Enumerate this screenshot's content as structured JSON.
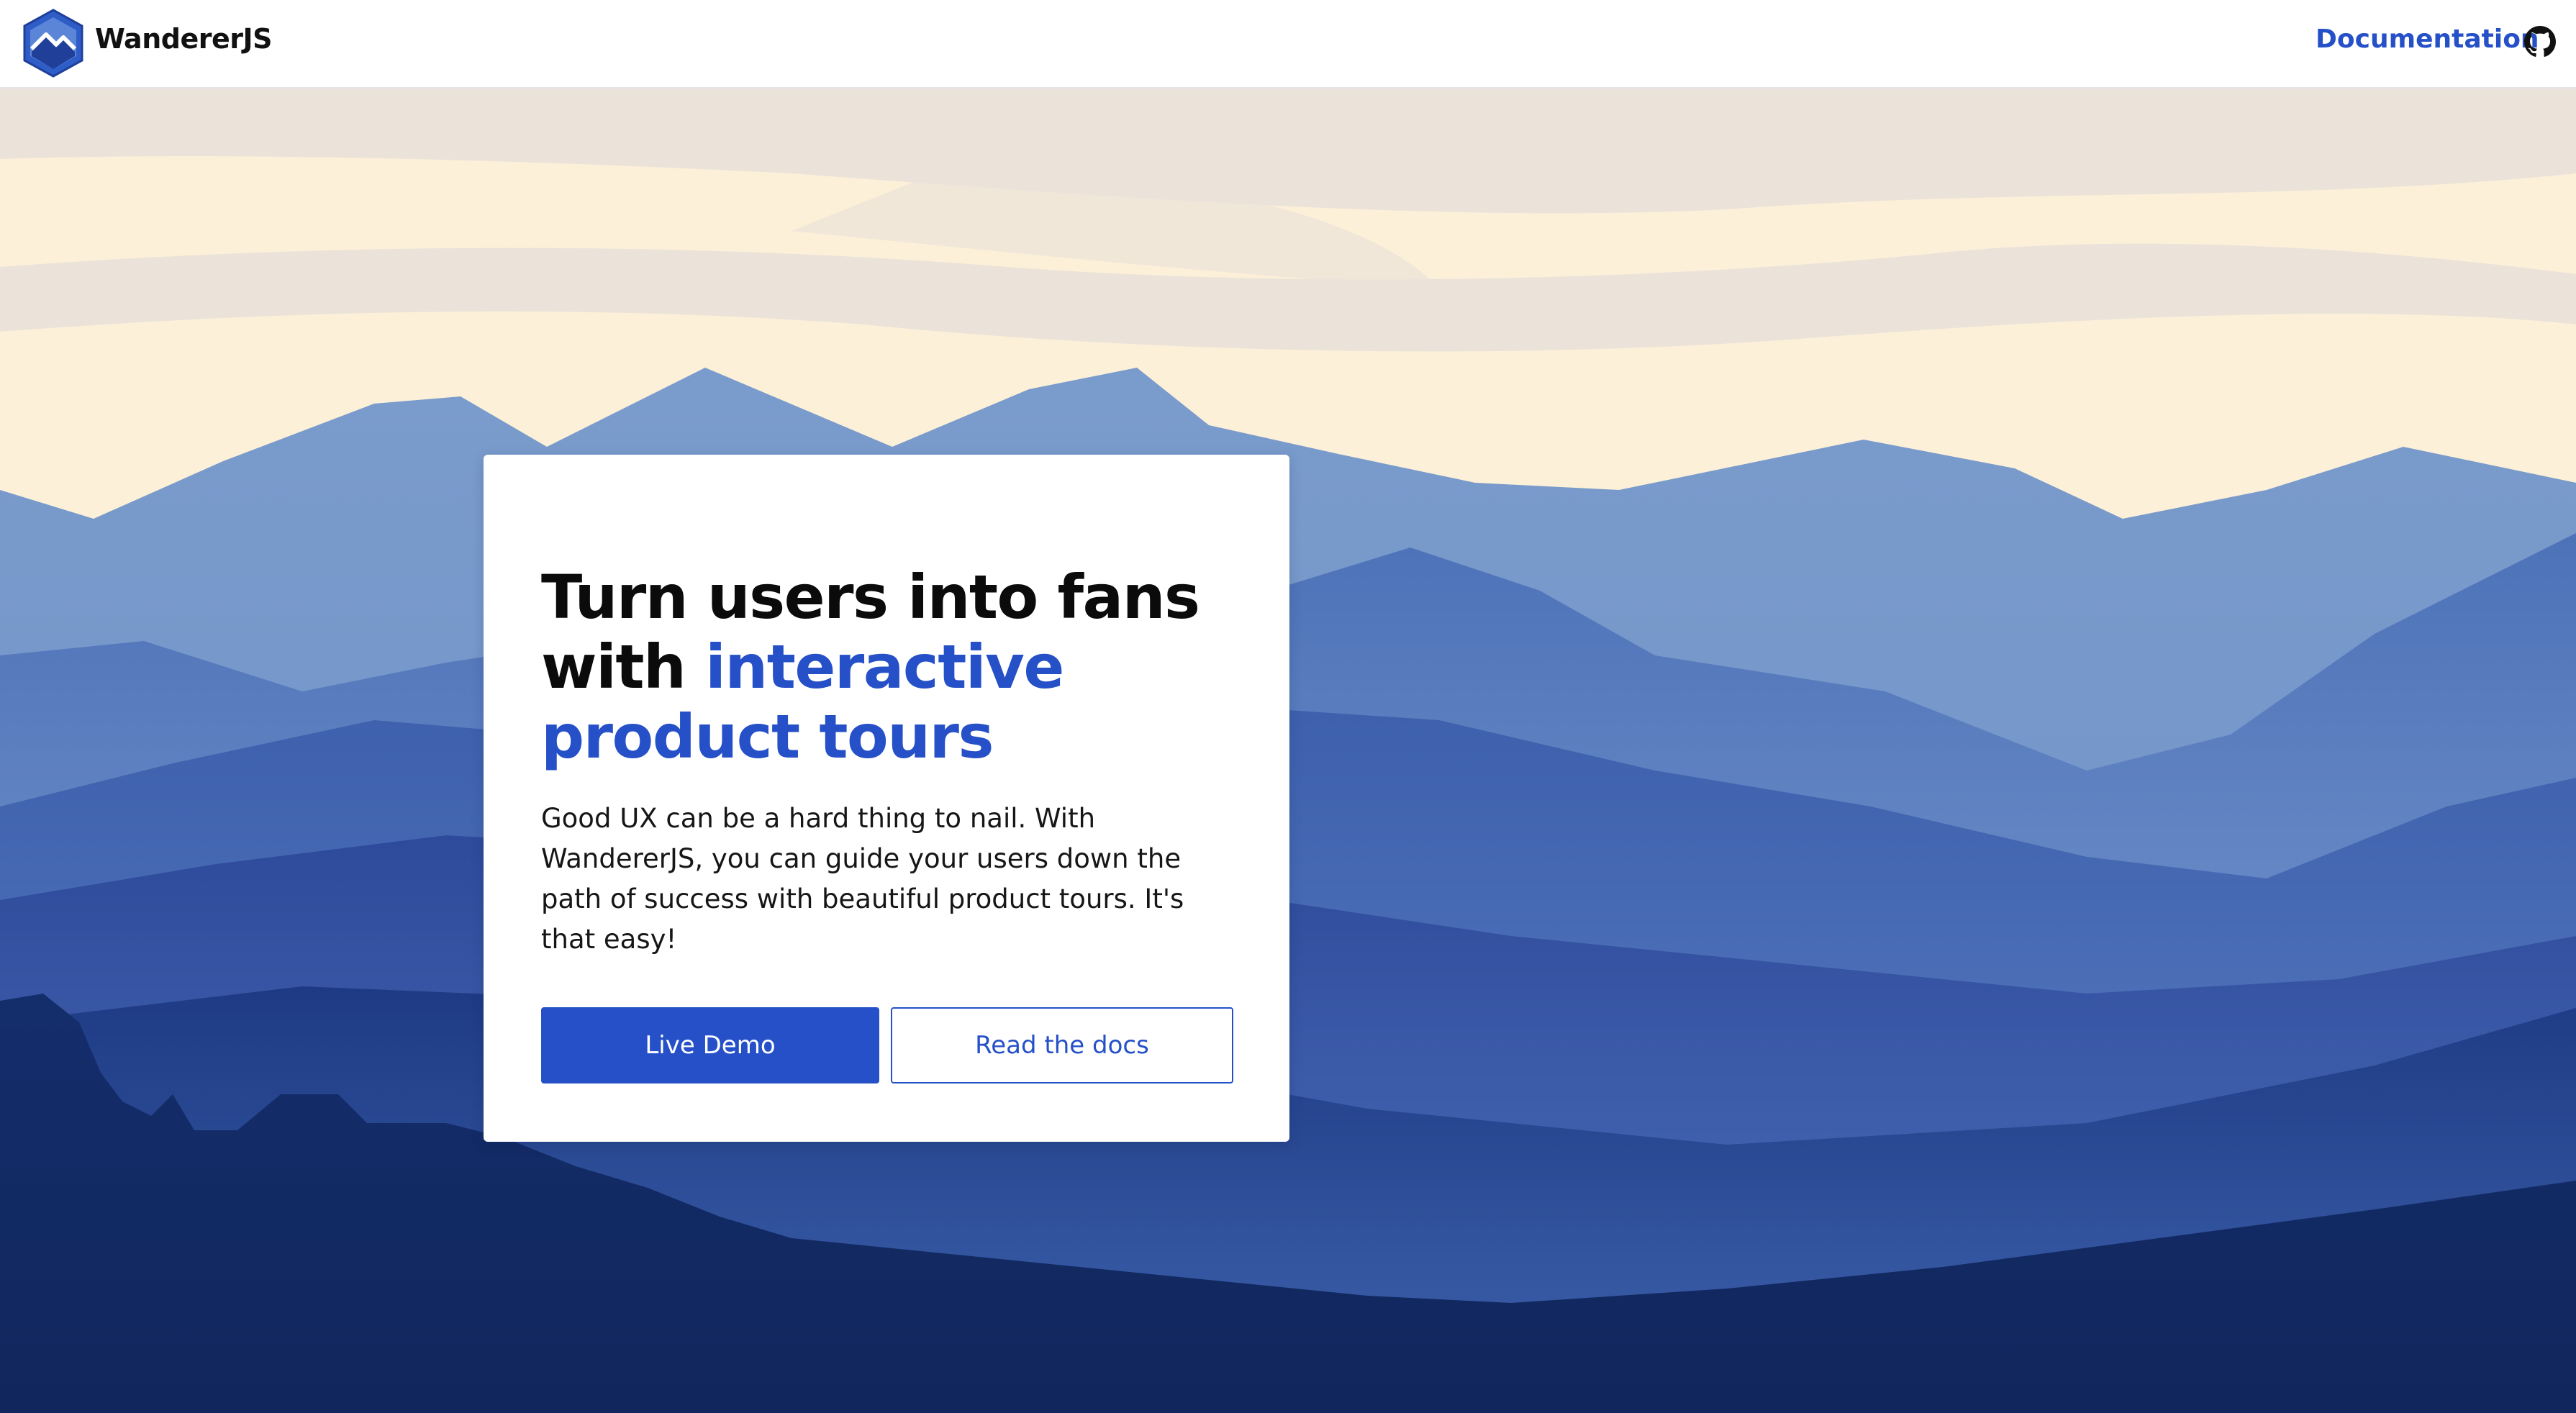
{
  "header": {
    "brand": "WandererJS",
    "nav": {
      "documentation": "Documentation"
    },
    "github_icon": "github-icon",
    "logo_icon": "mountain-hexagon-logo"
  },
  "hero": {
    "headline_part1": "Turn users into fans with ",
    "headline_accent": "interactive product tours",
    "description": "Good UX can be a hard thing to nail. With WandererJS, you can guide your users down the path of success with beautiful product tours. It's that easy!",
    "primary_button": "Live Demo",
    "secondary_button": "Read the docs"
  },
  "colors": {
    "accent": "#2550c8",
    "sky": "#fdf0d8",
    "mountains_far": "#7796c8",
    "mountains_deep": "#12275f"
  }
}
